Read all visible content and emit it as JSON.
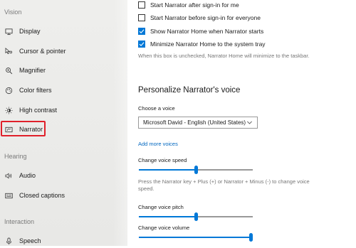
{
  "sidebar": {
    "section_vision": "Vision",
    "section_hearing": "Hearing",
    "section_interaction": "Interaction",
    "items": {
      "display": "Display",
      "cursor_pointer": "Cursor & pointer",
      "magnifier": "Magnifier",
      "color_filters": "Color filters",
      "high_contrast": "High contrast",
      "narrator": "Narrator",
      "audio": "Audio",
      "closed_captions": "Closed captions",
      "speech": "Speech"
    },
    "highlight_color": "#e0202a"
  },
  "main": {
    "checkboxes": {
      "after_signin": {
        "label": "Start Narrator after sign-in for me",
        "checked": false
      },
      "before_signin": {
        "label": "Start Narrator before sign-in for everyone",
        "checked": false
      },
      "show_home": {
        "label": "Show Narrator Home when Narrator starts",
        "checked": true
      },
      "minimize_home": {
        "label": "Minimize Narrator Home to the system tray",
        "checked": true
      }
    },
    "minimize_note": "When this box is unchecked, Narrator Home will minimize to the taskbar.",
    "voice_heading": "Personalize Narrator's voice",
    "choose_voice_label": "Choose a voice",
    "voice_selected": "Microsoft David - English (United States)",
    "add_voices_link": "Add more voices",
    "speed_label": "Change voice speed",
    "speed_value": 0.5,
    "speed_note": "Press the Narrator key + Plus (+) or Narrator + Minus (-) to change voice speed.",
    "pitch_label": "Change voice pitch",
    "pitch_value": 0.5,
    "volume_label": "Change voice volume",
    "volume_value": 1.0,
    "accent_color": "#0078d7"
  }
}
